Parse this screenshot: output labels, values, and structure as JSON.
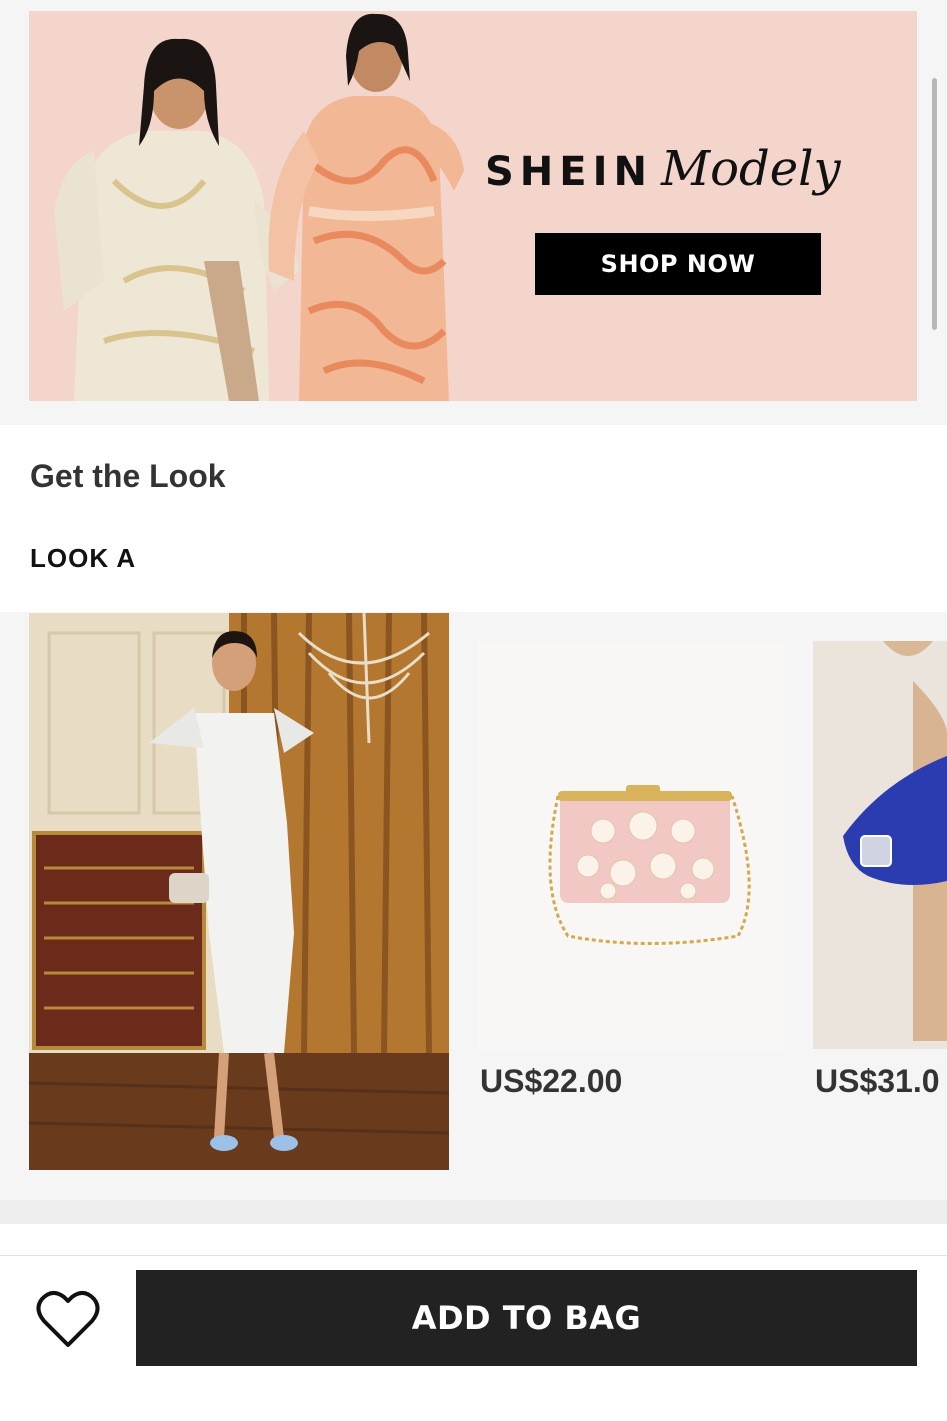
{
  "banner": {
    "brand_primary": "SHEIN",
    "brand_secondary": "Modely",
    "cta_label": "SHOP NOW",
    "background_color": "#f3d5cc"
  },
  "section": {
    "title": "Get the Look",
    "look_label": "LOOK A"
  },
  "products": [
    {
      "name": "pink-floral-clutch",
      "price": "US$22.00"
    },
    {
      "name": "blue-rhinestone-heels",
      "price": "US$31.0"
    }
  ],
  "bottom_bar": {
    "wishlist_icon": "heart-icon",
    "add_to_bag_label": "ADD TO BAG"
  }
}
